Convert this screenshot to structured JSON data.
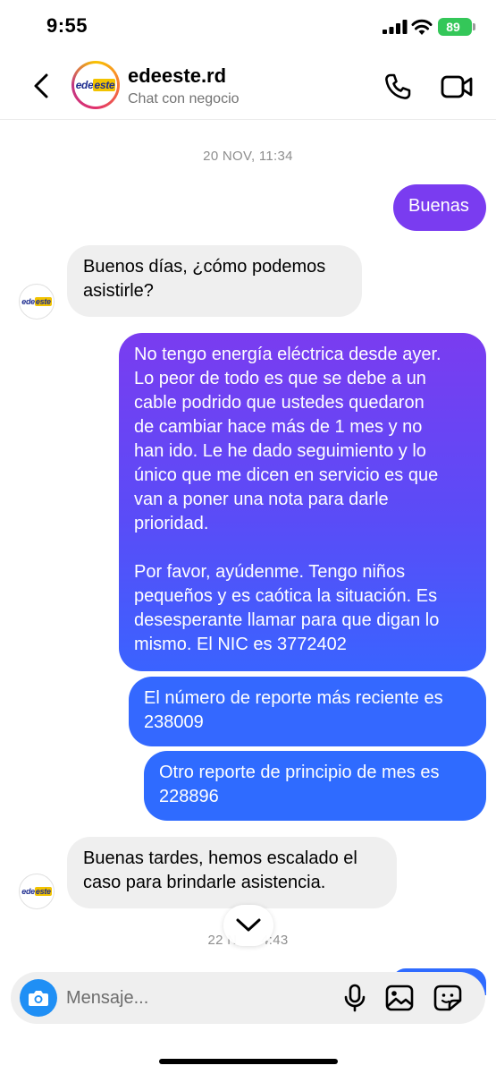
{
  "status_bar": {
    "time": "9:55",
    "battery": "89"
  },
  "header": {
    "back_icon": "chevron-left-icon",
    "avatar_logo": {
      "prefix": "ede",
      "highlight": "este"
    },
    "contact_name": "edeeste.rd",
    "subtitle": "Chat con negocio",
    "call_icon": "phone-icon",
    "video_icon": "video-camera-icon"
  },
  "messages": {
    "date_1": "20 NOV, 11:34",
    "m1": "Buenas",
    "m2": "Buenos días, ¿cómo podemos\nasistirle?",
    "m3": "No tengo energía eléctrica desde ayer.\nLo peor de todo es que se debe a un\ncable podrido que ustedes quedaron\nde cambiar hace más de 1 mes y no\nhan ido. Le he dado seguimiento y lo\núnico que me dicen en servicio es que\nvan a poner una nota para darle\nprioridad.\n\nPor favor, ayúdenme. Tengo niños\npequeños y es caótica la situación. Es\ndesesperante llamar para que digan lo\nmismo. El NIC es 3772402",
    "m4": "El número de reporte más reciente es\n238009",
    "m5": "Otro reporte de principio de mes es\n228896",
    "m6": "Buenas tardes, hemos escalado el\ncaso para brindarle asistencia.",
    "date_2": "22 N      4:43"
  },
  "composer": {
    "placeholder": "Mensaje...",
    "camera_icon": "camera-icon",
    "mic_icon": "microphone-icon",
    "gallery_icon": "image-icon",
    "sticker_icon": "sticker-icon"
  },
  "colors": {
    "outgoing_top": "#7a3cf0",
    "outgoing_bottom": "#3166ff",
    "incoming": "#efefef",
    "camera_button": "#1f8ff5",
    "battery": "#34c759"
  }
}
